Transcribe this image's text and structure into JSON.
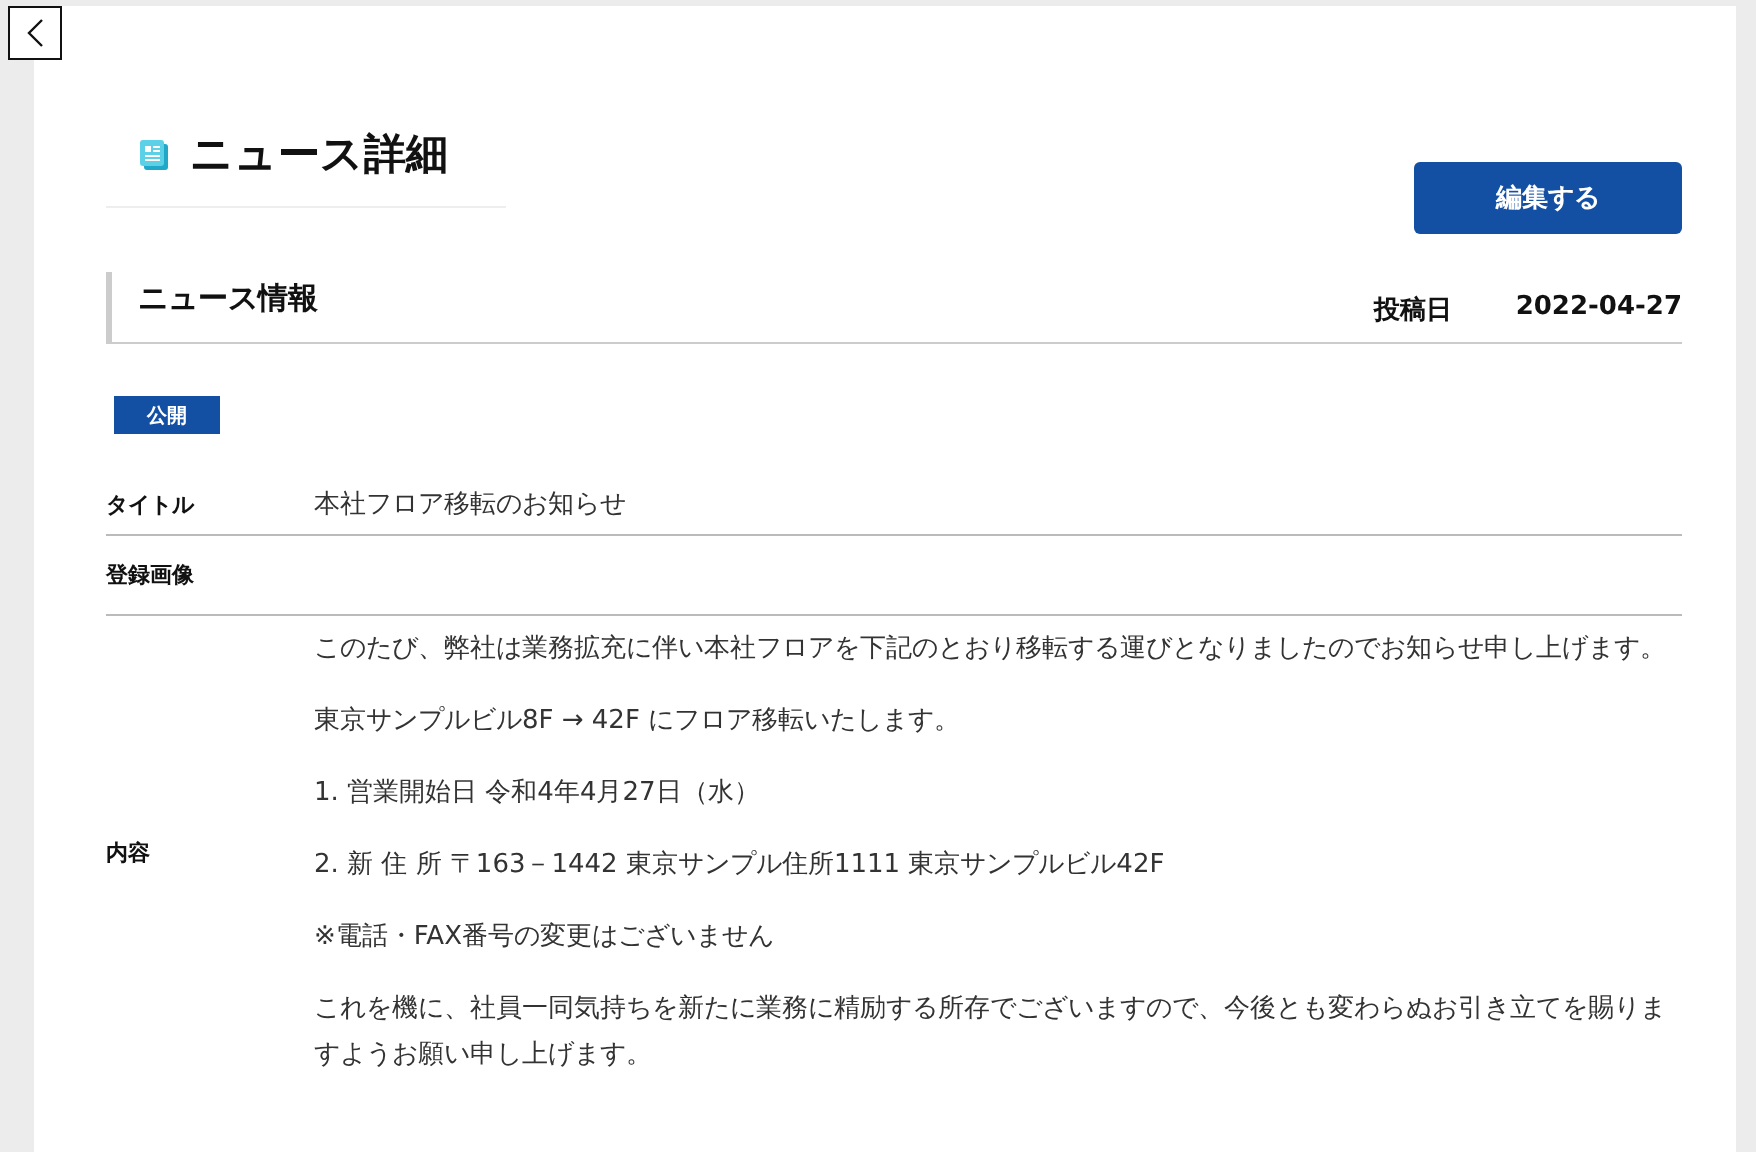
{
  "page": {
    "title": "ニュース詳細"
  },
  "edit_button": {
    "label": "編集する"
  },
  "section": {
    "title": "ニュース情報",
    "posted_label": "投稿日",
    "posted_date": "2022-04-27"
  },
  "status_badge": {
    "label": "公開"
  },
  "fields": [
    {
      "label": "タイトル",
      "kind": "text",
      "value": "本社フロア移転のお知らせ"
    },
    {
      "label": "登録画像",
      "kind": "image"
    },
    {
      "label": "内容",
      "kind": "paragraphs",
      "paragraphs": [
        "このたび、弊社は業務拡充に伴い本社フロアを下記のとおり移転する運びとなりましたのでお知らせ申し上げます。",
        "東京サンプルビル8F → 42F にフロア移転いたします。",
        "1. 営業開始日 令和4年4月27日（水）",
        "2. 新 住 所 〒163－1442 東京サンプル住所1111 東京サンプルビル42F",
        "※電話・FAX番号の変更はございません",
        "これを機に、社員一同気持ちを新たに業務に精励する所存でございますので、今後とも変わらぬお引き立てを賜りますようお願い申し上げます。"
      ]
    }
  ]
}
